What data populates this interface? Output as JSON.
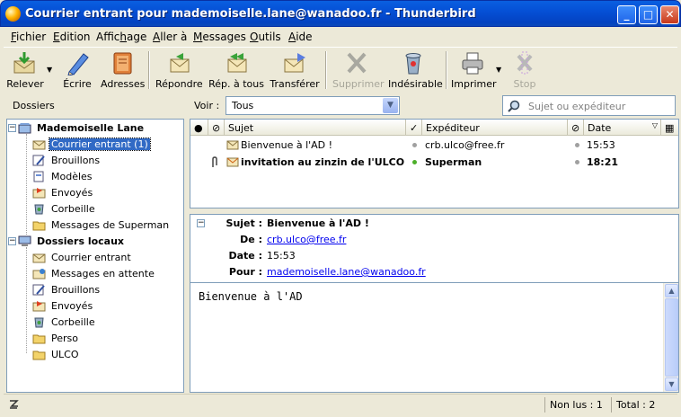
{
  "window": {
    "title": "Courrier entrant pour mademoiselle.lane@wanadoo.fr - Thunderbird",
    "controls": {
      "minimize": "_",
      "maximize": "□",
      "close": "✕"
    }
  },
  "menu": [
    {
      "pre": "",
      "u": "F",
      "post": "ichier"
    },
    {
      "pre": "",
      "u": "E",
      "post": "dition"
    },
    {
      "pre": "Affic",
      "u": "h",
      "post": "age"
    },
    {
      "pre": "",
      "u": "A",
      "post": "ller à"
    },
    {
      "pre": "",
      "u": "M",
      "post": "essages"
    },
    {
      "pre": "",
      "u": "O",
      "post": "utils"
    },
    {
      "pre": "",
      "u": "A",
      "post": "ide"
    }
  ],
  "toolbar": {
    "releve": "Relever",
    "ecrire": "Écrire",
    "adresses": "Adresses",
    "repondre": "Répondre",
    "rep_tous": "Rép. à tous",
    "transferer": "Transférer",
    "supprimer": "Supprimer",
    "indesirable": "Indésirable",
    "imprimer": "Imprimer",
    "stop": "Stop"
  },
  "folder_header": {
    "dossiers": "Dossiers",
    "voir_label": "Voir :",
    "voir_value": "Tous",
    "search_placeholder": "Sujet ou expéditeur"
  },
  "folders": {
    "account1": "Mademoiselle Lane",
    "a1_items": [
      "Courrier entrant (1)",
      "Brouillons",
      "Modèles",
      "Envoyés",
      "Corbeille",
      "Messages de Superman"
    ],
    "account2": "Dossiers locaux",
    "a2_items": [
      "Courrier entrant",
      "Messages en attente",
      "Brouillons",
      "Envoyés",
      "Corbeille",
      "Perso",
      "ULCO"
    ]
  },
  "thread_columns": {
    "sujet": "Sujet",
    "expediteur": "Expéditeur",
    "date": "Date"
  },
  "messages": [
    {
      "subject": "Bienvenue à l'AD !",
      "sender": "crb.ulco@free.fr",
      "date": "15:53"
    },
    {
      "subject": "invitation au zinzin de l'ULCO",
      "sender": "Superman",
      "date": "18:21"
    }
  ],
  "message_header": {
    "sujet_label": "Sujet :",
    "sujet": "Bienvenue à l'AD !",
    "de_label": "De :",
    "de": "crb.ulco@free.fr",
    "date_label": "Date :",
    "date": "15:53",
    "pour_label": "Pour :",
    "pour": "mademoiselle.lane@wanadoo.fr"
  },
  "message_body": "Bienvenue à l'AD",
  "status": {
    "unread": "Non lus : 1",
    "total": "Total : 2"
  }
}
